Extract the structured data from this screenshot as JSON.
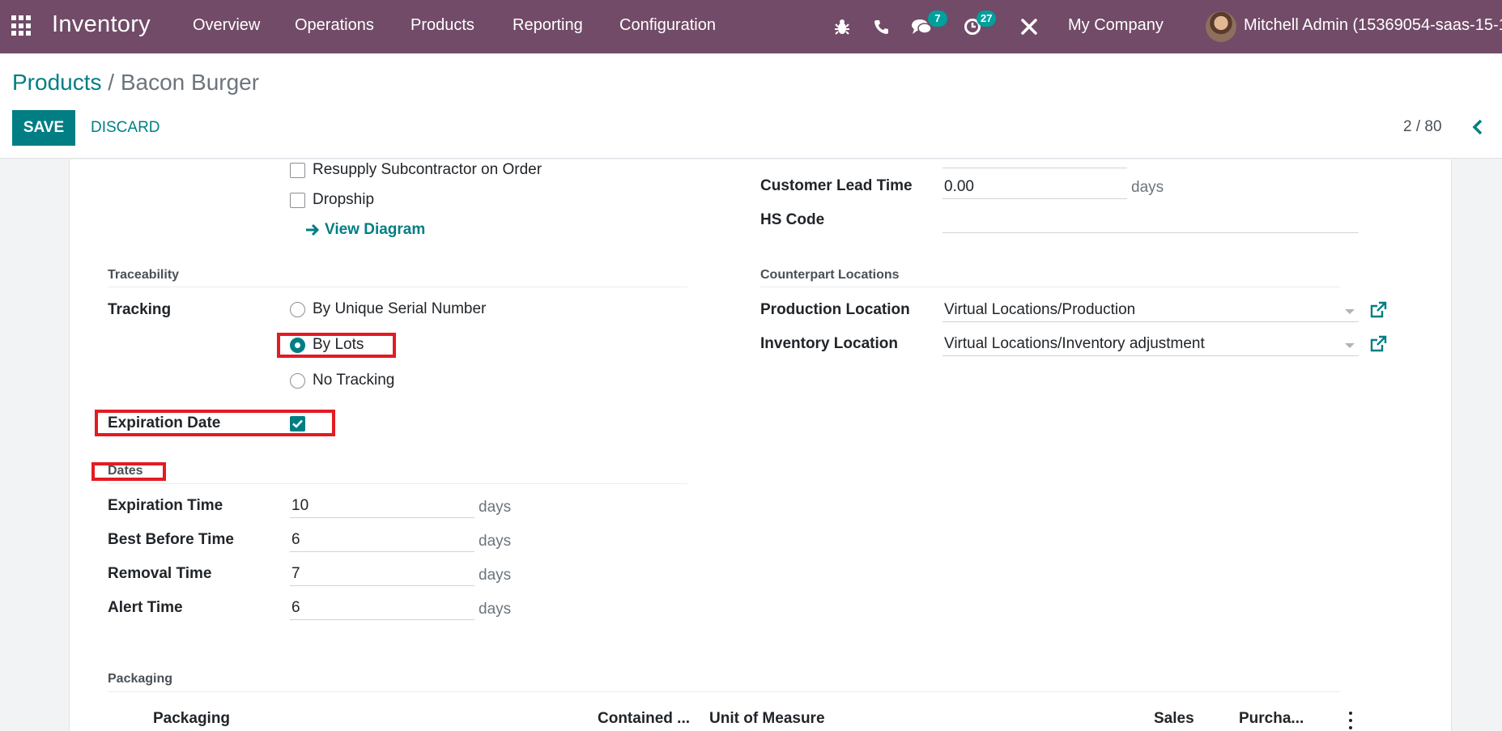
{
  "navbar": {
    "app_name": "Inventory",
    "menu": [
      "Overview",
      "Operations",
      "Products",
      "Reporting",
      "Configuration"
    ],
    "messages_badge": "7",
    "activities_badge": "27",
    "company": "My Company",
    "user": "Mitchell Admin (15369054-saas-15-1",
    "bar_color": "#714b67"
  },
  "control": {
    "breadcrumb_parent": "Products",
    "breadcrumb_sep": " / ",
    "breadcrumb_current": "Bacon Burger",
    "save_label": "SAVE",
    "discard_label": "DISCARD",
    "pager": "2 / 80"
  },
  "left": {
    "resupply_label": "Resupply Subcontractor on Order",
    "dropship_label": "Dropship",
    "view_diagram": "View Diagram",
    "traceability_title": "Traceability",
    "tracking_label": "Tracking",
    "tracking_options": [
      "By Unique Serial Number",
      "By Lots",
      "No Tracking"
    ],
    "tracking_selected": "By Lots",
    "expiration_date_label": "Expiration Date",
    "expiration_date_checked": true,
    "dates_title": "Dates",
    "dates": [
      {
        "label": "Expiration Time",
        "value": "10",
        "unit": "days"
      },
      {
        "label": "Best Before Time",
        "value": "6",
        "unit": "days"
      },
      {
        "label": "Removal Time",
        "value": "7",
        "unit": "days"
      },
      {
        "label": "Alert Time",
        "value": "6",
        "unit": "days"
      }
    ]
  },
  "right": {
    "customer_lead_label": "Customer Lead Time",
    "customer_lead_value": "0.00",
    "customer_lead_unit": "days",
    "hs_code_label": "HS Code",
    "hs_code_value": "",
    "counterpart_title": "Counterpart Locations",
    "production_label": "Production Location",
    "production_value": "Virtual Locations/Production",
    "inventory_label": "Inventory Location",
    "inventory_value": "Virtual Locations/Inventory adjustment"
  },
  "packaging": {
    "title": "Packaging",
    "columns": [
      "Packaging",
      "Contained ...",
      "Unit of Measure",
      "Sales",
      "Purcha..."
    ]
  },
  "colors": {
    "accent": "#017e84",
    "highlight": "#e31b23"
  }
}
